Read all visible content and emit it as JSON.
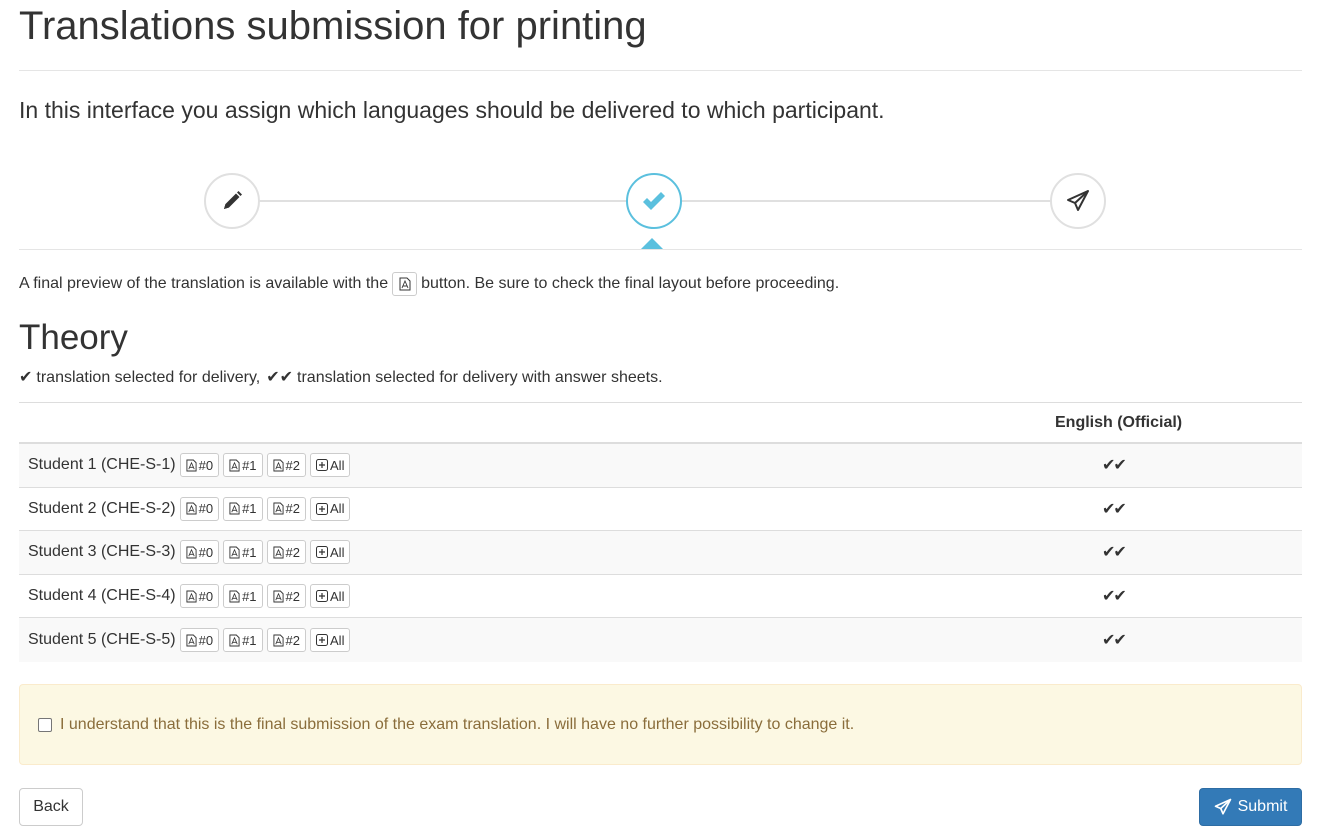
{
  "page": {
    "title": "Translations submission for printing",
    "lead": "In this interface you assign which languages should be delivered to which participant."
  },
  "wizard": {
    "steps": [
      {
        "icon": "pencil-icon"
      },
      {
        "icon": "checkmark-icon",
        "active": true
      },
      {
        "icon": "paper-plane-icon"
      }
    ],
    "active_color": "#5bc0de"
  },
  "info": {
    "before": "A final preview of the translation is available with the",
    "after": "button. Be sure to check the final layout before proceeding."
  },
  "section": {
    "title": "Theory",
    "legend_single": "translation selected for delivery,",
    "legend_double": "translation selected for delivery with answer sheets."
  },
  "table": {
    "language_header": "English (Official)",
    "buttons": [
      "#0",
      "#1",
      "#2",
      "All"
    ],
    "rows": [
      {
        "student": "Student 1 (CHE-S-1)",
        "selection": "✔✔"
      },
      {
        "student": "Student 2 (CHE-S-2)",
        "selection": "✔✔"
      },
      {
        "student": "Student 3 (CHE-S-3)",
        "selection": "✔✔"
      },
      {
        "student": "Student 4 (CHE-S-4)",
        "selection": "✔✔"
      },
      {
        "student": "Student 5 (CHE-S-5)",
        "selection": "✔✔"
      }
    ]
  },
  "confirm": {
    "text": "I understand that this is the final submission of the exam translation. I will have no further possibility to change it.",
    "checked": false
  },
  "actions": {
    "back_label": "Back",
    "submit_label": "Submit"
  },
  "colors": {
    "primary": "#337ab7",
    "warning_bg": "#fcf8e3",
    "warning_text": "#8a6d3b",
    "info": "#5bc0de"
  }
}
